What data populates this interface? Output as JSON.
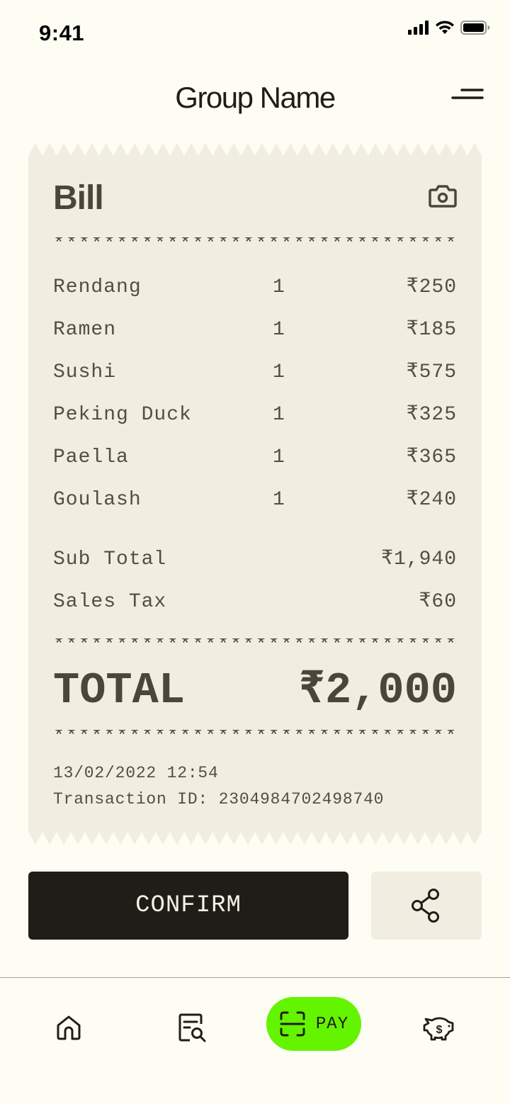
{
  "status_bar": {
    "time": "9:41",
    "icons": [
      "cellular-icon",
      "wifi-icon",
      "battery-icon"
    ]
  },
  "header": {
    "title": "Group Name",
    "menu_icon": "menu-icon"
  },
  "bill": {
    "title": "Bill",
    "camera_icon": "camera-icon",
    "divider": "****************************************",
    "items": [
      {
        "name": "Rendang",
        "qty": "1",
        "price": "₹250"
      },
      {
        "name": "Ramen",
        "qty": "1",
        "price": "₹185"
      },
      {
        "name": "Sushi",
        "qty": "1",
        "price": "₹575"
      },
      {
        "name": "Peking Duck",
        "qty": "1",
        "price": "₹325"
      },
      {
        "name": "Paella",
        "qty": "1",
        "price": "₹365"
      },
      {
        "name": "Goulash",
        "qty": "1",
        "price": "₹240"
      }
    ],
    "subtotal": {
      "label": "Sub Total",
      "value": "₹1,940"
    },
    "tax": {
      "label": "Sales Tax",
      "value": "₹60"
    },
    "total": {
      "label": "TOTAL",
      "value": "₹2,000"
    },
    "datetime": "13/02/2022 12:54",
    "transaction": "Transaction ID: 2304984702498740"
  },
  "actions": {
    "confirm_label": "CONFIRM",
    "share_icon": "share-icon"
  },
  "tabbar": {
    "home_icon": "home-icon",
    "search_receipt_icon": "receipt-search-icon",
    "pay_label": "PAY",
    "pay_icon": "scan-icon",
    "savings_icon": "piggy-bank-icon",
    "pay_color": "#64F400"
  },
  "colors": {
    "background": "#FDFDF4",
    "receipt": "#F1EDE0",
    "text_dark": "#1F1D17",
    "receipt_text": "#524F3F"
  }
}
